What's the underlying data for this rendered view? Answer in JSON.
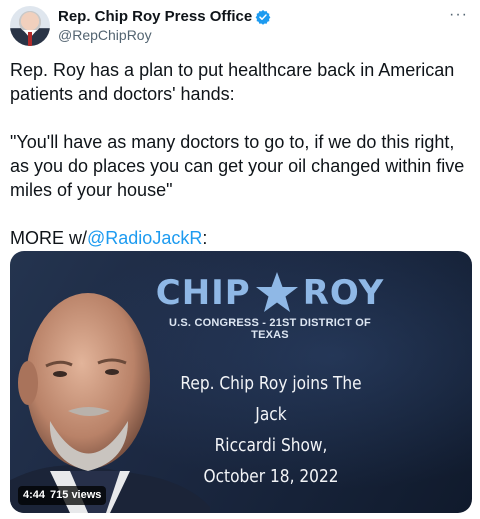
{
  "account": {
    "name": "Rep. Chip Roy Press Office",
    "handle": "@RepChipRoy",
    "verified": true,
    "verified_color": "#1d9bf0"
  },
  "menu": {
    "more_label": "···"
  },
  "tweet": {
    "line1": "Rep. Roy has a plan to put healthcare back in American patients and doctors' hands:",
    "line2": "\"You'll have as many doctors to go to, if we do this right, as you do places you can get your oil changed within five miles of your house\"",
    "more_prefix": "MORE w/",
    "mention": "@RadioJackR",
    "more_suffix": ":"
  },
  "media": {
    "brand_left": "CHIP",
    "brand_right": "ROY",
    "subtitle": "U.S. CONGRESS - 21ST DISTRICT OF TEXAS",
    "episode_line1": "Rep. Chip Roy joins The Jack",
    "episode_line2": "Riccardi Show,",
    "episode_line3": "October 18, 2022",
    "duration": "4:44",
    "views": "715 views",
    "brand_color": "#8fb8e6"
  }
}
